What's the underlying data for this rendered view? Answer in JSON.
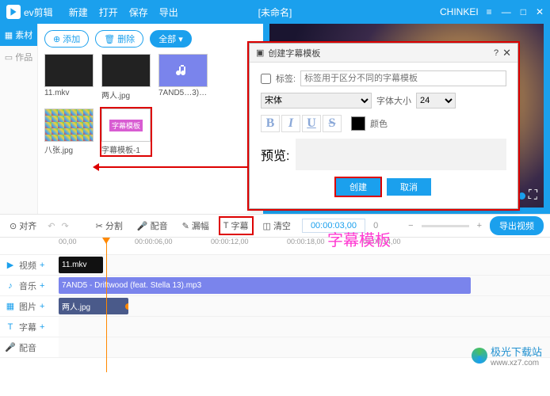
{
  "titlebar": {
    "app": "ev剪辑",
    "menu": [
      "新建",
      "打开",
      "保存",
      "导出"
    ],
    "title": "[未命名]",
    "user": "CHINKEI"
  },
  "tabs": {
    "material": "素材",
    "works": "作品"
  },
  "library": {
    "add": "添加",
    "delete": "删除",
    "all": "全部",
    "items": [
      {
        "label": "11.mkv"
      },
      {
        "label": "两人.jpg"
      },
      {
        "label": "7AND5…3).mp3"
      },
      {
        "label": "八张.jpg"
      },
      {
        "label": "字幕模板-1",
        "tmpl_text": "字幕模板"
      }
    ]
  },
  "dialog": {
    "title": "创建字幕模板",
    "tag_label": "标签:",
    "tag_placeholder": "标签用于区分不同的字幕模板",
    "font": "宋体",
    "size_label": "字体大小",
    "size": "24",
    "color_label": "颜色",
    "preview_label": "预览:",
    "annotation": "字幕模板",
    "create": "创建",
    "cancel": "取消"
  },
  "toolbar": {
    "align": "对齐",
    "tools": {
      "split": "分割",
      "mute": "配音",
      "mosaic": "漏幅",
      "subtitle": "字幕",
      "clear": "清空"
    },
    "time": "00:00:03,00",
    "zero": "0",
    "export": "导出视频"
  },
  "ruler": [
    "00,00",
    "00:00:06,00",
    "00:00:12,00",
    "00:00:18,00",
    "00:00:24,00"
  ],
  "tracks": {
    "video": "视频",
    "audio": "音乐",
    "image": "图片",
    "subtitle": "字幕",
    "dub": "配音"
  },
  "clips": {
    "video": "11.mkv",
    "audio": "7AND5 - Driftwood (feat. Stella 13).mp3",
    "image": "两人.jpg"
  },
  "watermark": {
    "name": "极光下载站",
    "url": "www.xz7.com"
  }
}
